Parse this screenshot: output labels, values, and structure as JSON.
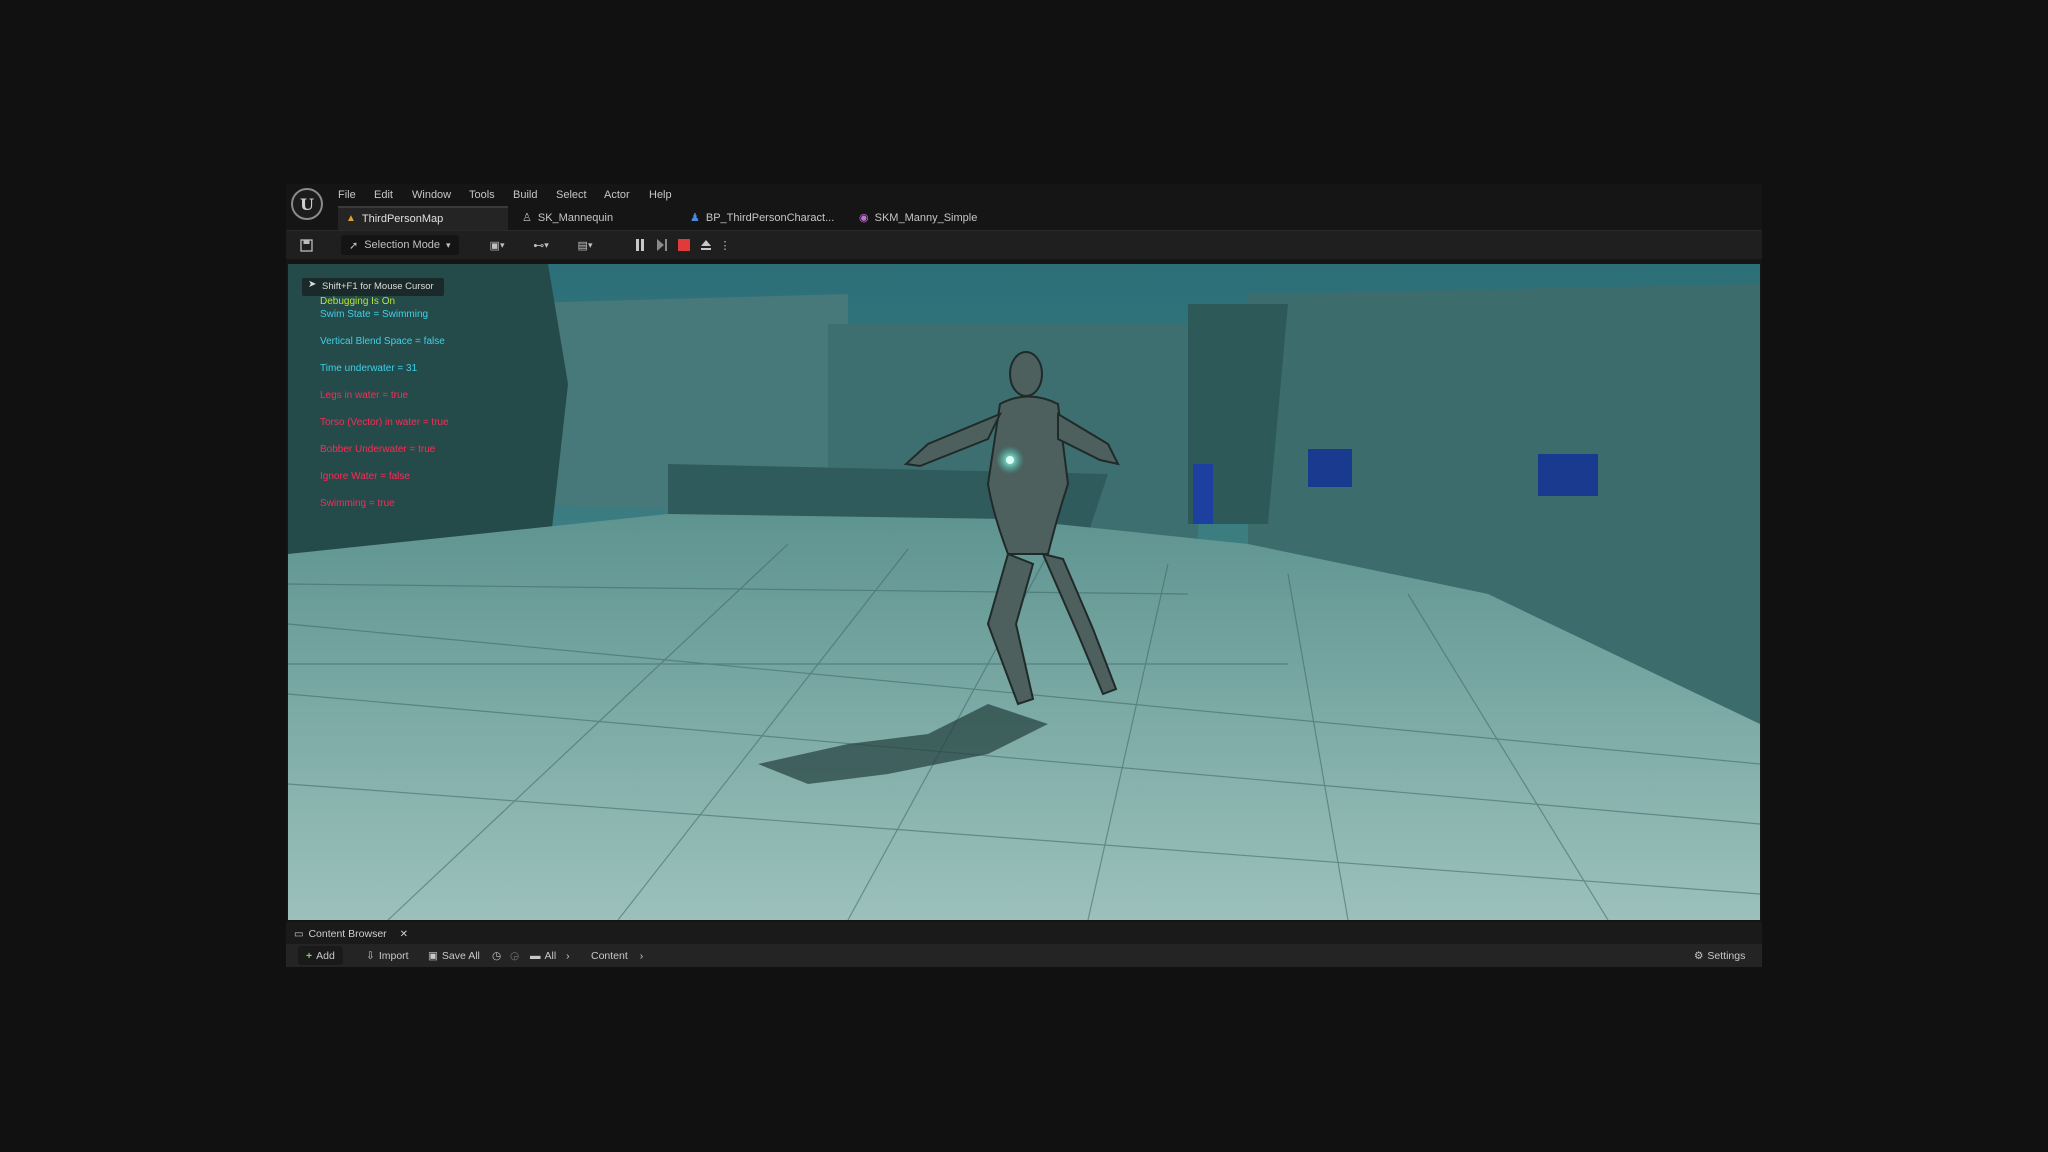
{
  "menu": [
    "File",
    "Edit",
    "Window",
    "Tools",
    "Build",
    "Select",
    "Actor",
    "Help"
  ],
  "tabs": [
    "ThirdPersonMap",
    "SK_Mannequin",
    "BP_ThirdPersonCharact...",
    "SKM_Manny_Simple"
  ],
  "toolbar": {
    "selection_mode": "Selection Mode"
  },
  "viewport": {
    "hint": "Shift+F1 for Mouse Cursor",
    "debug_lines": [
      {
        "text": "Debugging Is On",
        "color": "#b8e63a"
      },
      {
        "text": "Swim State = Swimming",
        "color": "#3fd0e8"
      },
      {
        "text": "Vertical Blend Space = false",
        "color": "#3fd0e8"
      },
      {
        "text": "Time underwater = 31",
        "color": "#3fd0e8"
      },
      {
        "text": "Legs in water = true",
        "color": "#ff2a55"
      },
      {
        "text": "Torso (Vector) in water = true",
        "color": "#ff2a55"
      },
      {
        "text": "Bobber Underwater = true",
        "color": "#ff2a55"
      },
      {
        "text": "Ignore Water = false",
        "color": "#ff2a55"
      },
      {
        "text": "Swimming = true",
        "color": "#ff2a55"
      }
    ]
  },
  "content_browser": {
    "tab_label": "Content Browser",
    "add": "Add",
    "import": "Import",
    "save_all": "Save All",
    "path_all": "All",
    "path_content": "Content",
    "settings": "Settings"
  }
}
